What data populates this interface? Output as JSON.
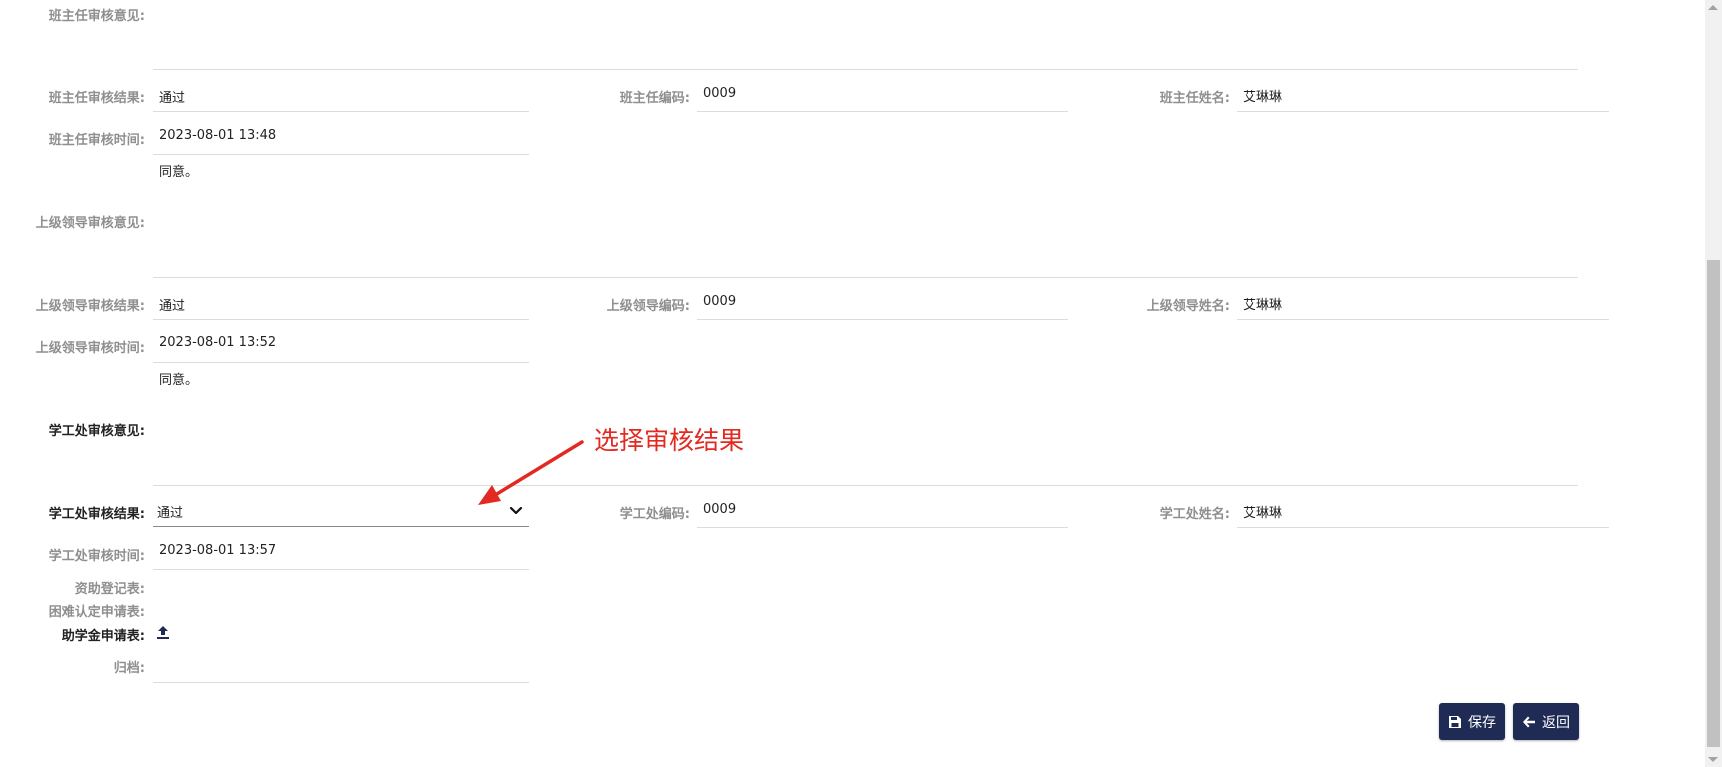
{
  "sections": [
    {
      "opinion_label": "班主任审核意见:",
      "result_label": "班主任审核结果:",
      "result_value": "通过",
      "code_label": "班主任编码:",
      "code_value": "0009",
      "name_label": "班主任姓名:",
      "name_value": "艾琳琳",
      "time_label": "班主任审核时间:",
      "time_value": "2023-08-01 13:48",
      "next_opinion_text": "同意。"
    },
    {
      "opinion_label": "上级领导审核意见:",
      "result_label": "上级领导审核结果:",
      "result_value": "通过",
      "code_label": "上级领导编码:",
      "code_value": "0009",
      "name_label": "上级领导姓名:",
      "name_value": "艾琳琳",
      "time_label": "上级领导审核时间:",
      "time_value": "2023-08-01 13:52",
      "next_opinion_text": "同意。"
    },
    {
      "opinion_label": "学工处审核意见:",
      "result_label": "学工处审核结果:",
      "result_value": "通过",
      "code_label": "学工处编码:",
      "code_value": "0009",
      "name_label": "学工处姓名:",
      "name_value": "艾琳琳",
      "time_label": "学工处审核时间:",
      "time_value": "2023-08-01 13:57"
    }
  ],
  "attachments": {
    "funding_label": "资助登记表:",
    "hardship_label": "困难认定申请表:",
    "grant_label": "助学金申请表:",
    "archive_label": "归档:"
  },
  "buttons": {
    "save_label": "保存",
    "back_label": "返回"
  },
  "annotation": {
    "text": "选择审核结果",
    "color": "#e32a22"
  },
  "icons": {
    "chevron": "chevron-down-icon",
    "upload": "upload-icon",
    "save": "floppy-disk-icon",
    "back": "arrow-left-icon"
  },
  "colors": {
    "button_bg": "#1f2a55",
    "label_gray": "#8f8f8f",
    "annotation_red": "#e32a22"
  }
}
